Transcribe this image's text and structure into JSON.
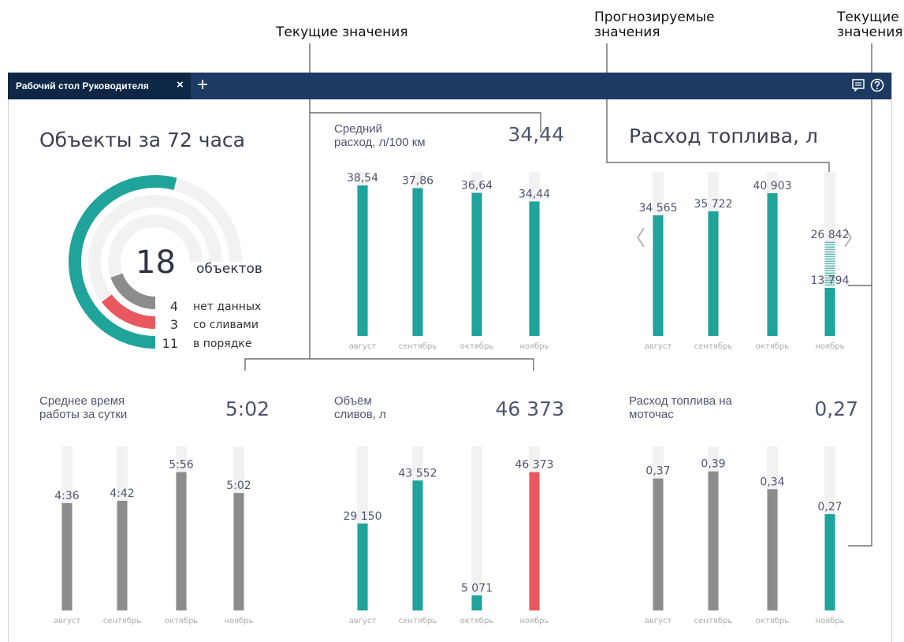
{
  "callouts": {
    "current_values_top": "Текущие значения",
    "forecast_line1": "Прогнозируемые",
    "forecast_line2": "значения",
    "current_right_line1": "Текущие",
    "current_right_line2": "значения"
  },
  "header": {
    "tab_label": "Рабочий стол Руководителя",
    "close_glyph": "×",
    "add_glyph": "+",
    "icons": [
      "comment-icon",
      "help-icon"
    ]
  },
  "colors": {
    "teal": "#1fa39a",
    "gray": "#8c8c8c",
    "red": "#e8585e",
    "track": "#f2f2f2",
    "navy": "#1d3a63"
  },
  "objects": {
    "title": "Объекты за 72 часа",
    "total": "18",
    "total_label": "объектов",
    "items": [
      {
        "count": "4",
        "label": "нет данных",
        "color": "#8c8c8c",
        "fraction": 0.222
      },
      {
        "count": "3",
        "label": "со сливами",
        "color": "#e8585e",
        "fraction": 0.167
      },
      {
        "count": "11",
        "label": "в порядке",
        "color": "#1fa39a",
        "fraction": 0.611
      }
    ]
  },
  "panels": {
    "avg_consumption": {
      "title_line1": "Средний",
      "title_line2": "расход, л/100 км",
      "value": "34,44"
    },
    "fuel_consumption": {
      "title": "Расход топлива, л",
      "prev_glyph": "〈",
      "next_glyph": "〉"
    },
    "avg_worktime": {
      "title_line1": "Среднее время",
      "title_line2": "работы за сутки",
      "value": "5:02"
    },
    "drain_volume": {
      "title_line1": "Объём",
      "title_line2": "сливов, л",
      "value": "46 373"
    },
    "fuel_per_motohour": {
      "title_line1": "Расход топлива на",
      "title_line2": "моточас",
      "value": "0,27"
    }
  },
  "chart_data": [
    {
      "id": "avg_consumption",
      "type": "bar",
      "categories": [
        "август",
        "сентябрь",
        "октябрь",
        "ноябрь"
      ],
      "values": [
        38.54,
        37.86,
        36.64,
        34.44
      ],
      "labels": [
        "38,54",
        "37,86",
        "36,64",
        "34,44"
      ],
      "colors": [
        "#1fa39a",
        "#1fa39a",
        "#1fa39a",
        "#1fa39a"
      ],
      "ylim": [
        0,
        42
      ]
    },
    {
      "id": "fuel_consumption",
      "type": "bar",
      "categories": [
        "август",
        "сентябрь",
        "октябрь",
        "ноябрь"
      ],
      "values": [
        34565,
        35722,
        40903,
        13794
      ],
      "labels": [
        "34 565",
        "35 722",
        "40 903",
        "13 794"
      ],
      "forecast": {
        "index": 3,
        "value": 26842,
        "label": "26 842"
      },
      "colors": [
        "#1fa39a",
        "#1fa39a",
        "#1fa39a",
        "#1fa39a"
      ],
      "ylim": [
        0,
        47000
      ]
    },
    {
      "id": "avg_worktime",
      "type": "bar",
      "categories": [
        "август",
        "сентябрь",
        "октябрь",
        "ноябрь"
      ],
      "values": [
        276,
        282,
        356,
        302
      ],
      "labels": [
        "4:36",
        "4:42",
        "5:56",
        "5:02"
      ],
      "colors": [
        "#8c8c8c",
        "#8c8c8c",
        "#8c8c8c",
        "#8c8c8c"
      ],
      "ylim": [
        0,
        422
      ]
    },
    {
      "id": "drain_volume",
      "type": "bar",
      "categories": [
        "август",
        "сентябрь",
        "октябрь",
        "ноябрь"
      ],
      "values": [
        29150,
        43552,
        5071,
        46373
      ],
      "labels": [
        "29 150",
        "43 552",
        "5 071",
        "46 373"
      ],
      "colors": [
        "#1fa39a",
        "#1fa39a",
        "#1fa39a",
        "#e8585e"
      ],
      "ylim": [
        0,
        55000
      ]
    },
    {
      "id": "fuel_per_motohour",
      "type": "bar",
      "categories": [
        "август",
        "сентябрь",
        "октябрь",
        "ноябрь"
      ],
      "values": [
        0.37,
        0.39,
        0.34,
        0.27
      ],
      "labels": [
        "0,37",
        "0,39",
        "0,34",
        "0,27"
      ],
      "colors": [
        "#8c8c8c",
        "#8c8c8c",
        "#8c8c8c",
        "#1fa39a"
      ],
      "ylim": [
        0,
        0.46
      ]
    }
  ]
}
